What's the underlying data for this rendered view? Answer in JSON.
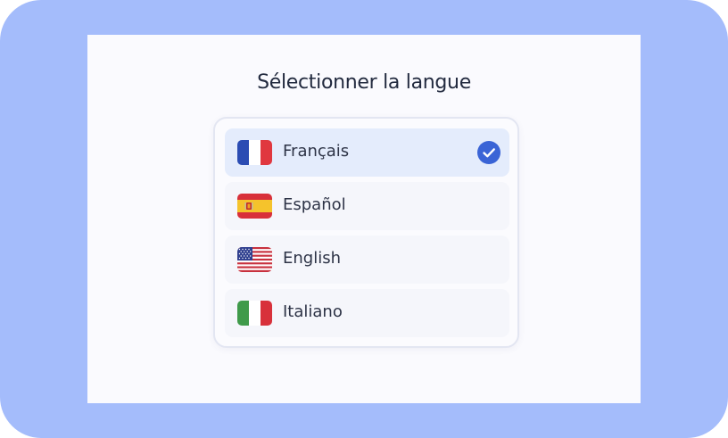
{
  "page": {
    "title": "Sélectionner la langue"
  },
  "languages": [
    {
      "label": "Français",
      "flag": "france-flag-icon",
      "selected": true
    },
    {
      "label": "Español",
      "flag": "spain-flag-icon",
      "selected": false
    },
    {
      "label": "English",
      "flag": "us-flag-icon",
      "selected": false
    },
    {
      "label": "Italiano",
      "flag": "italy-flag-icon",
      "selected": false
    }
  ],
  "colors": {
    "frame": "#a4bcfb",
    "accent": "#3a64d6",
    "selected_bg": "#e4ecfc"
  }
}
